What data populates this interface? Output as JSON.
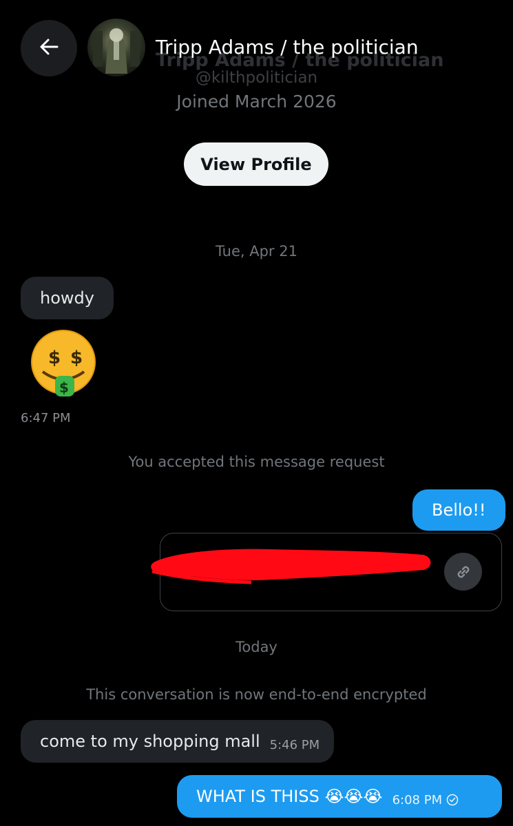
{
  "header": {
    "name": "Tripp Adams / the politician",
    "handle": "@kilthpolitician",
    "joined": "Joined March 2026",
    "view_profile_label": "View Profile"
  },
  "conversation": {
    "date_1": "Tue, Apr 21",
    "msg_howdy": "howdy",
    "emoji_time": "6:47 PM",
    "accepted_notice": "You accepted this message request",
    "msg_bello": "Bello!!",
    "date_2": "Today",
    "encrypted_notice": "This conversation is now end-to-end encrypted",
    "msg_mall": "come to my shopping mall",
    "msg_mall_time": "5:46 PM",
    "msg_what": "WHAT IS THISS 😭😭😭",
    "msg_what_time": "6:08 PM"
  },
  "icons": [
    "back-arrow-icon",
    "money-mouth-face-icon",
    "link-icon",
    "read-check-icon",
    "loudly-crying-face-icon"
  ],
  "colors": {
    "background": "#000000",
    "incoming_bubble": "#202327",
    "outgoing_bubble": "#1d9bf0",
    "redaction": "#ff0a14"
  }
}
